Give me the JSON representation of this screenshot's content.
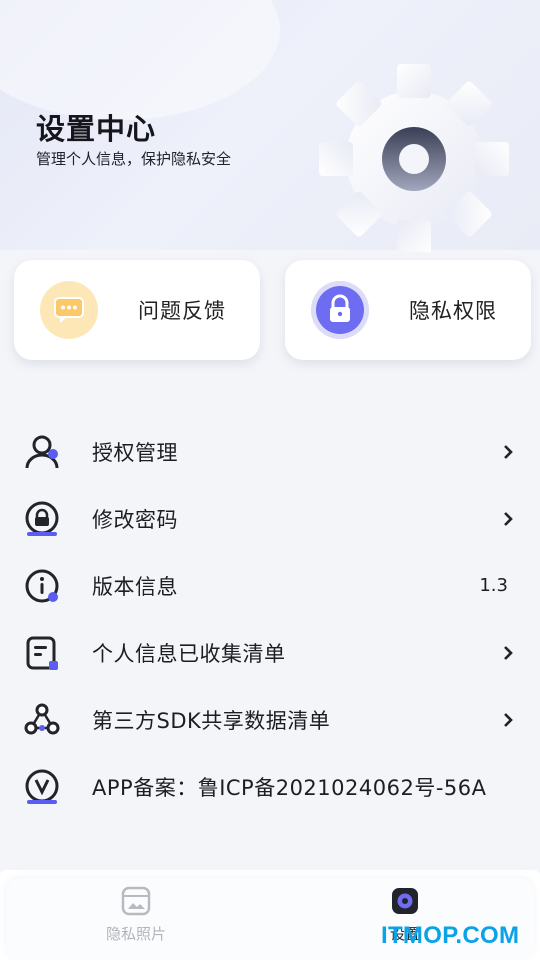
{
  "header": {
    "title": "设置中心",
    "subtitle": "管理个人信息，保护隐私安全",
    "decoration": "gear-illustration"
  },
  "quick_cards": [
    {
      "label": "问题反馈",
      "icon": "message-icon",
      "color": "#fbc86a"
    },
    {
      "label": "隐私权限",
      "icon": "lock-icon",
      "color": "#6e6cf0"
    }
  ],
  "menu": [
    {
      "label": "授权管理",
      "icon": "user-icon",
      "chevron": true
    },
    {
      "label": "修改密码",
      "icon": "password-lock-icon",
      "chevron": true
    },
    {
      "label": "版本信息",
      "icon": "info-icon",
      "value": "1.3"
    },
    {
      "label": "个人信息已收集清单",
      "icon": "document-icon",
      "chevron": true
    },
    {
      "label": "第三方SDK共享数据清单",
      "icon": "share-network-icon",
      "chevron": true
    },
    {
      "label": "APP备案：鲁ICP备2021024062号-56A",
      "icon": "record-v-icon"
    }
  ],
  "tabbar": {
    "tabs": [
      {
        "label": "隐私照片",
        "icon": "photo-icon",
        "active": false
      },
      {
        "label": "设置",
        "icon": "settings-icon",
        "active": true
      }
    ]
  },
  "watermark": "ITMOP.COM",
  "colors": {
    "accent": "#5b5cf0",
    "background": "#f4f5f9",
    "icon_dark": "#22232b"
  }
}
